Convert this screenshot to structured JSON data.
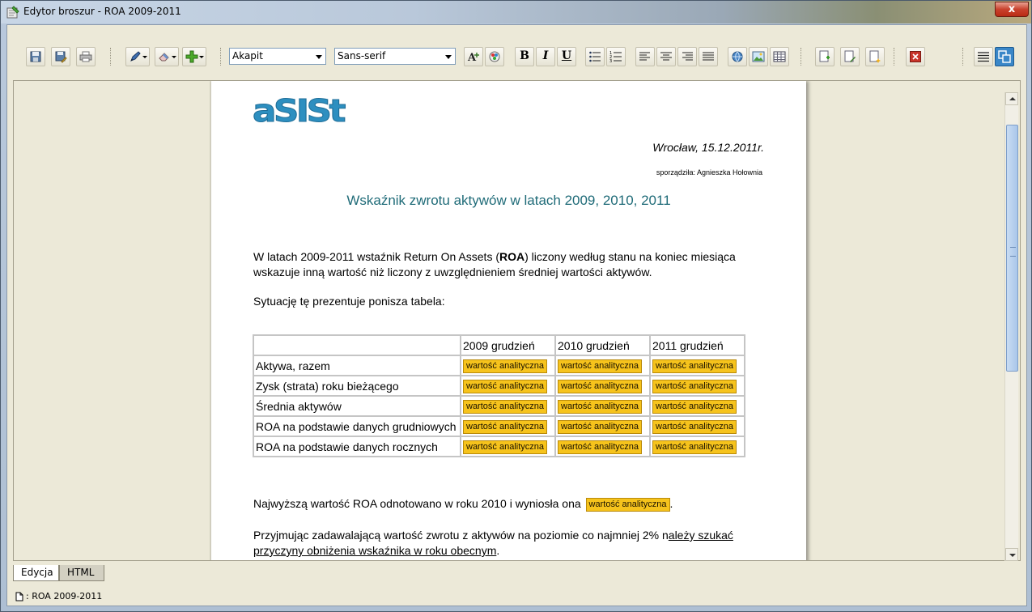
{
  "window": {
    "title": "Edytor broszur - ROA 2009-2011",
    "close_label": "x"
  },
  "toolbar": {
    "paragraph_style": "Akapit",
    "font_family": "Sans-serif",
    "bold_label": "B",
    "italic_label": "I",
    "underline_label": "U"
  },
  "document": {
    "logo_text": "aSISt",
    "date": "Wrocław, 15.12.2011r.",
    "author": "sporządziła: Agnieszka Hołownia",
    "title": "Wskaźnik zwrotu aktywów w latach 2009, 2010, 2011",
    "para1_before": "W latach 2009-2011 wstaźnik Return On Assets  (",
    "para1_bold": "ROA",
    "para1_after": ") liczony według stanu na koniec miesiąca wskazuje inną wartość niż liczony z uwzględnieniem średniej wartości aktywów.",
    "para2": "Sytuację tę prezentuje ponisza tabela:",
    "table": {
      "headers": [
        "",
        "2009 grudzień",
        "2010 grudzień",
        "2011 grudzień"
      ],
      "rows": [
        {
          "label": "Aktywa, razem",
          "cells": [
            "wartość analityczna",
            "wartość analityczna",
            "wartość analityczna"
          ]
        },
        {
          "label": "Zysk (strata) roku bieżącego",
          "cells": [
            "wartość analityczna",
            "wartość analityczna",
            "wartość analityczna"
          ]
        },
        {
          "label": "Średnia aktywów",
          "cells": [
            "wartość analityczna",
            "wartość analityczna",
            "wartość analityczna"
          ]
        },
        {
          "label": "ROA na podstawie danych grudniowych",
          "cells": [
            "wartość analityczna",
            "wartość analityczna",
            "wartość analityczna"
          ]
        },
        {
          "label": "ROA na podstawie danych rocznych",
          "cells": [
            "wartość analityczna",
            "wartość analityczna",
            "wartość analityczna"
          ]
        }
      ]
    },
    "para3_text": "Najwyższą wartość ROA odnotowano w roku 2010 i wyniosła ona",
    "para3_chip": "wartość analityczna",
    "para3_end": ".",
    "para4_plain": "Przyjmując zadawalającą wartość zwrotu z aktywów na poziomie co najmniej 2% n",
    "para4_underlined": "ależy szukać przyczyny obniżenia wskaźnika w roku obecnym",
    "para4_end": "."
  },
  "tabs": [
    {
      "label": "Edycja",
      "active": true
    },
    {
      "label": "HTML",
      "active": false
    }
  ],
  "status": {
    "text": ": ROA 2009-2011"
  },
  "colors": {
    "title": "#1f6b78",
    "chip": "#f6c31c",
    "logo": "#2d8fc0"
  },
  "icons": [
    "save-icon",
    "save-as-icon",
    "print-icon",
    "pen-icon",
    "eraser-icon",
    "add-icon",
    "font-color-icon",
    "color-palette-icon",
    "bullet-list-icon",
    "numbered-list-icon",
    "align-left-icon",
    "align-center-icon",
    "align-right-icon",
    "align-justify-icon",
    "globe-link-icon",
    "image-icon",
    "table-icon",
    "insert-page-icon",
    "edit-page-icon",
    "new-page-icon",
    "delete-icon",
    "list-view-icon",
    "window-view-icon"
  ]
}
